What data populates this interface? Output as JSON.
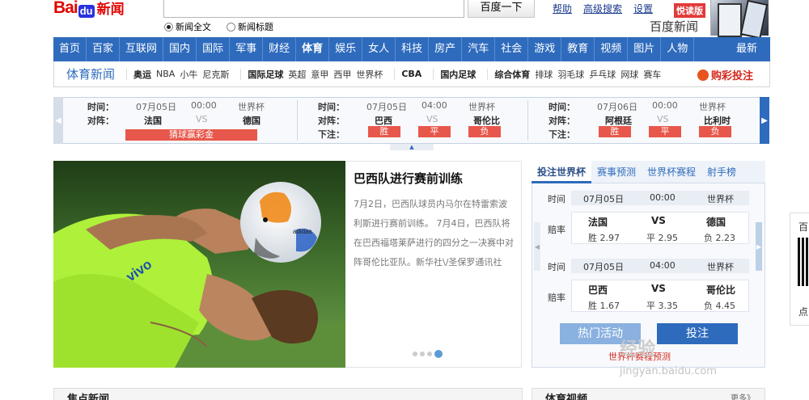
{
  "header": {
    "logo_bai": "Bai",
    "logo_du": "du",
    "logo_xinwen": "新闻",
    "search_button": "百度一下",
    "radio_fulltext": "新闻全文",
    "radio_title": "新闻标题",
    "links": [
      "帮助",
      "高级搜索",
      "设置"
    ],
    "yuedu_badge": "悦读版",
    "baidu_news": "百度新闻"
  },
  "nav": {
    "items": [
      "首页",
      "百家",
      "互联网",
      "国内",
      "国际",
      "军事",
      "财经",
      "体育",
      "娱乐",
      "女人",
      "科技",
      "房产",
      "汽车",
      "社会",
      "游戏",
      "教育",
      "视频",
      "图片",
      "人物"
    ],
    "active": "体育",
    "last": "最新"
  },
  "subnav": {
    "title": "体育新闻",
    "groups": [
      {
        "bold": "奥运",
        "items": [
          "NBA",
          "小牛",
          "尼克斯"
        ]
      },
      {
        "bold": "国际足球",
        "items": [
          "英超",
          "意甲",
          "西甲",
          "世界杯"
        ]
      },
      {
        "bold": "CBA",
        "items": []
      },
      {
        "bold": "国内足球",
        "items": []
      },
      {
        "bold": "综合体育",
        "items": [
          "排球",
          "羽毛球",
          "乒乓球",
          "网球",
          "赛车"
        ]
      }
    ],
    "goucai": "购彩投注"
  },
  "ticker": {
    "label_time": "时间：",
    "label_match": "对阵：",
    "label_bet": "下注：",
    "matches": [
      {
        "date": "07月05日",
        "time": "00:00",
        "league": "世界杯",
        "home": "法国",
        "away": "德国",
        "bar": "猜球赢彩金"
      },
      {
        "date": "07月05日",
        "time": "04:00",
        "league": "世界杯",
        "home": "巴西",
        "away": "哥伦比",
        "odds": [
          "胜",
          "平",
          "负"
        ]
      },
      {
        "date": "07月06日",
        "time": "00:00",
        "league": "世界杯",
        "home": "阿根廷",
        "away": "比利时",
        "odds": [
          "胜",
          "平",
          "负"
        ]
      }
    ],
    "vs": "VS"
  },
  "feature": {
    "title": "巴西队进行赛前训练",
    "body": "7月2日，巴西队球员内马尔在特雷索波利斯进行赛前训练。 7月4日，巴西队将在巴西福塔莱萨进行的四分之一决赛中对阵哥伦比亚队。新华社\\/圣保罗通讯社",
    "ball_brand": "adidas",
    "shirt_brand": "vivo"
  },
  "panel": {
    "tabs": [
      "投注世界杯",
      "赛事预测",
      "世界杯赛程",
      "射手榜"
    ],
    "label_time": "时间",
    "label_odds": "赔率",
    "matches": [
      {
        "date": "07月05日",
        "time": "00:00",
        "league": "世界杯",
        "home": "法国",
        "vs": "VS",
        "away": "德国",
        "win": "胜 2.97",
        "draw": "平 2.95",
        "lose": "负 2.23"
      },
      {
        "date": "07月05日",
        "time": "04:00",
        "league": "世界杯",
        "home": "巴西",
        "vs": "VS",
        "away": "哥伦比",
        "win": "胜 1.67",
        "draw": "平 3.35",
        "lose": "负 4.45"
      }
    ],
    "btn_hot": "热门活动",
    "btn_bet": "投注",
    "link": "世界杯赛程预测"
  },
  "watermark": {
    "line1": "经验",
    "line2": "jingyan.baidu.com"
  },
  "qr": {
    "top": "百",
    "bottom": "点"
  },
  "bottom": {
    "left_title": "焦点新闻",
    "right_title": "体育视频",
    "more": "更多》"
  },
  "colors": {
    "nav_blue": "#2e6bbd",
    "brand_red": "#e10602",
    "odds_red": "#e8574b"
  }
}
